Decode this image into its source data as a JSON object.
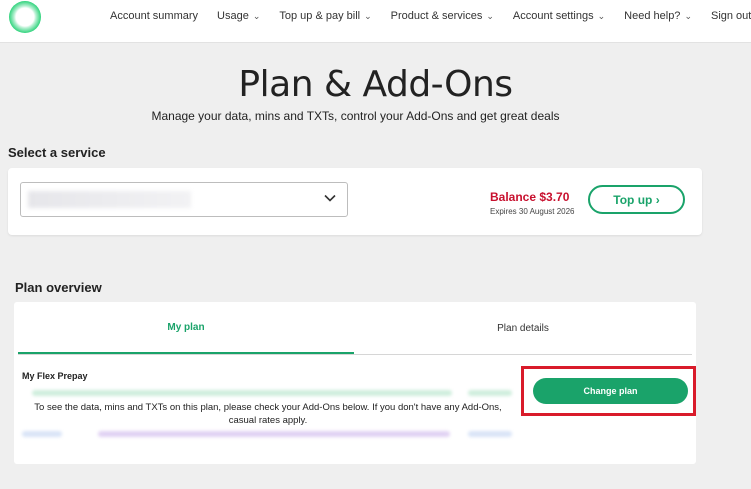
{
  "nav": {
    "items": [
      {
        "label": "Account summary",
        "dropdown": false
      },
      {
        "label": "Usage",
        "dropdown": true
      },
      {
        "label": "Top up & pay bill",
        "dropdown": true
      },
      {
        "label": "Product & services",
        "dropdown": true
      },
      {
        "label": "Account settings",
        "dropdown": true
      },
      {
        "label": "Need help?",
        "dropdown": true
      },
      {
        "label": "Sign out",
        "dropdown": false
      }
    ]
  },
  "page": {
    "title": "Plan & Add-Ons",
    "subtitle": "Manage your data, mins and TXTs, control your Add-Ons and get great deals"
  },
  "service": {
    "section_label": "Select a service",
    "balance": "Balance $3.70",
    "expires": "Expires 30 August 2026",
    "topup_label": "Top up ›"
  },
  "plan": {
    "section_label": "Plan overview",
    "tabs": [
      {
        "label": "My plan",
        "active": true
      },
      {
        "label": "Plan details",
        "active": false
      }
    ],
    "name": "My Flex Prepay",
    "message": "To see the data, mins and TXTs on this plan, please check your Add-Ons below. If you don't have any Add-Ons, casual rates apply.",
    "change_label": "Change plan"
  },
  "colors": {
    "accent": "#1aa36a",
    "balance": "#c8102e",
    "highlight": "#d91b2a"
  }
}
